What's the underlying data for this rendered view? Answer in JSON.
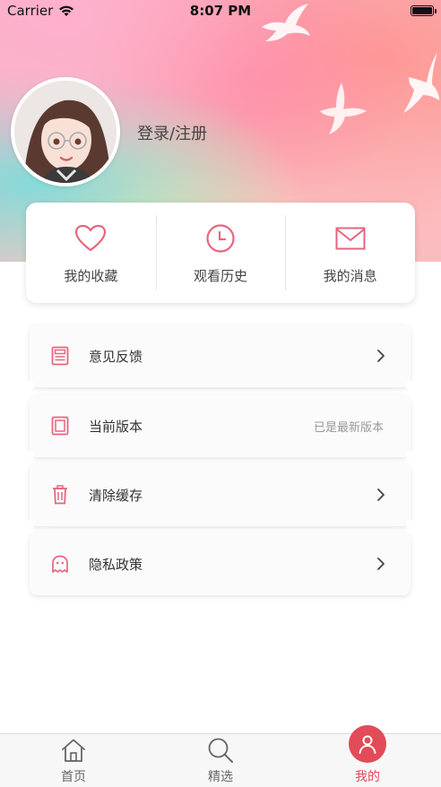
{
  "status_bar": {
    "carrier": "Carrier",
    "time": "8:07 PM"
  },
  "profile": {
    "login_text": "登录/注册"
  },
  "quick_actions": [
    {
      "label": "我的收藏",
      "icon": "heart-icon"
    },
    {
      "label": "观看历史",
      "icon": "clock-icon"
    },
    {
      "label": "我的消息",
      "icon": "mail-icon"
    }
  ],
  "menu": [
    {
      "label": "意见反馈",
      "icon": "feedback-icon",
      "value": ""
    },
    {
      "label": "当前版本",
      "icon": "version-icon",
      "value": "已是最新版本"
    },
    {
      "label": "清除缓存",
      "icon": "trash-icon",
      "value": ""
    },
    {
      "label": "隐私政策",
      "icon": "ghost-icon",
      "value": ""
    }
  ],
  "tabs": [
    {
      "label": "首页",
      "icon": "home-icon"
    },
    {
      "label": "精选",
      "icon": "search-icon"
    },
    {
      "label": "我的",
      "icon": "user-icon",
      "active": true
    }
  ],
  "colors": {
    "accent": "#e24b58",
    "icon_pink": "#e8657e"
  }
}
